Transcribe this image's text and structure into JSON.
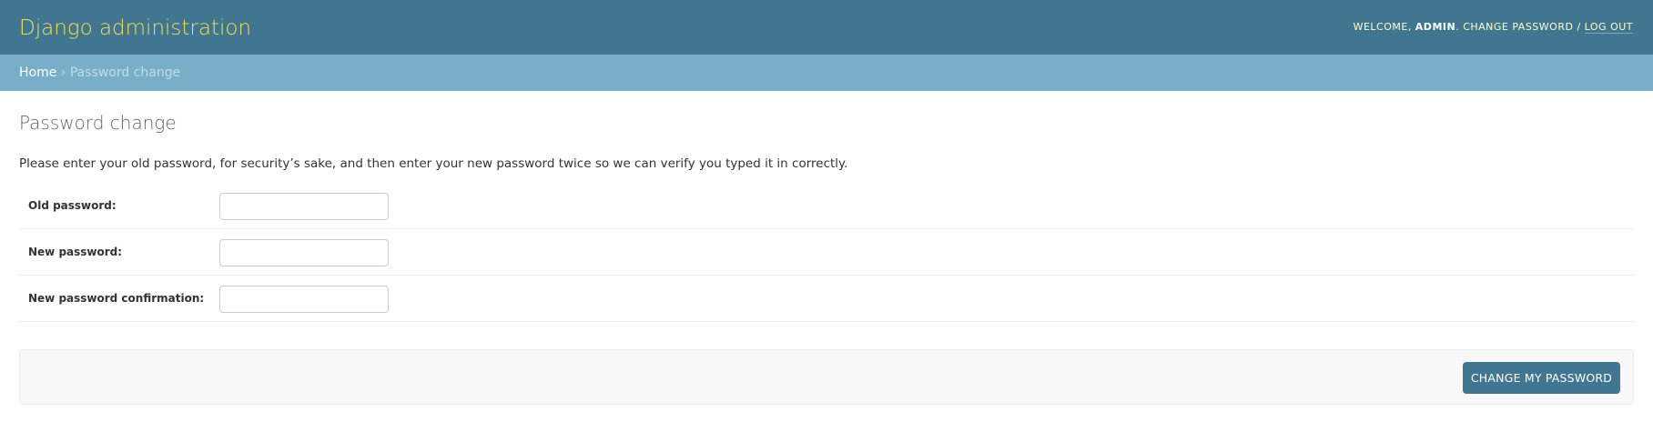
{
  "header": {
    "title": "Django administration",
    "welcome_text": "Welcome,",
    "user_name": "admin",
    "change_password_label": "Change password",
    "separator": "/",
    "logout_label": "Log out"
  },
  "breadcrumbs": {
    "home_label": "Home",
    "separator": "›",
    "current_label": "Password change"
  },
  "main": {
    "title": "Password change",
    "intro": "Please enter your old password, for security’s sake, and then enter your new password twice so we can verify you typed it in correctly.",
    "fields": [
      {
        "label": "Old password:",
        "value": ""
      },
      {
        "label": "New password:",
        "value": ""
      },
      {
        "label": "New password confirmation:",
        "value": ""
      }
    ],
    "submit_label": "Change my password"
  },
  "colors": {
    "header_bg": "#417690",
    "breadcrumb_bg": "#79aec8",
    "brand": "#f5dd5d",
    "button_bg": "#417690"
  }
}
